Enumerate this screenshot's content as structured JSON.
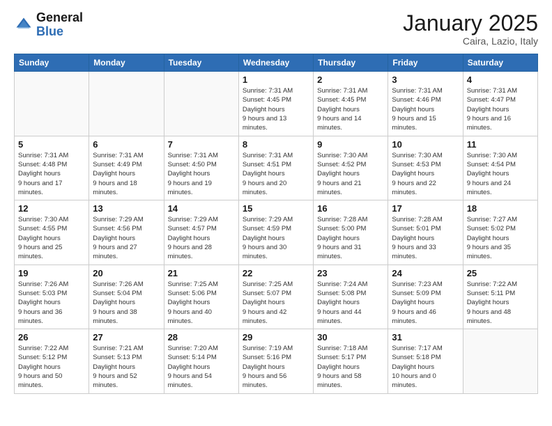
{
  "header": {
    "logo_general": "General",
    "logo_blue": "Blue",
    "month_title": "January 2025",
    "location": "Caira, Lazio, Italy"
  },
  "weekdays": [
    "Sunday",
    "Monday",
    "Tuesday",
    "Wednesday",
    "Thursday",
    "Friday",
    "Saturday"
  ],
  "weeks": [
    [
      {
        "day": "",
        "empty": true
      },
      {
        "day": "",
        "empty": true
      },
      {
        "day": "",
        "empty": true
      },
      {
        "day": "1",
        "sunrise": "7:31 AM",
        "sunset": "4:45 PM",
        "daylight": "9 hours and 13 minutes."
      },
      {
        "day": "2",
        "sunrise": "7:31 AM",
        "sunset": "4:45 PM",
        "daylight": "9 hours and 14 minutes."
      },
      {
        "day": "3",
        "sunrise": "7:31 AM",
        "sunset": "4:46 PM",
        "daylight": "9 hours and 15 minutes."
      },
      {
        "day": "4",
        "sunrise": "7:31 AM",
        "sunset": "4:47 PM",
        "daylight": "9 hours and 16 minutes."
      }
    ],
    [
      {
        "day": "5",
        "sunrise": "7:31 AM",
        "sunset": "4:48 PM",
        "daylight": "9 hours and 17 minutes."
      },
      {
        "day": "6",
        "sunrise": "7:31 AM",
        "sunset": "4:49 PM",
        "daylight": "9 hours and 18 minutes."
      },
      {
        "day": "7",
        "sunrise": "7:31 AM",
        "sunset": "4:50 PM",
        "daylight": "9 hours and 19 minutes."
      },
      {
        "day": "8",
        "sunrise": "7:31 AM",
        "sunset": "4:51 PM",
        "daylight": "9 hours and 20 minutes."
      },
      {
        "day": "9",
        "sunrise": "7:30 AM",
        "sunset": "4:52 PM",
        "daylight": "9 hours and 21 minutes."
      },
      {
        "day": "10",
        "sunrise": "7:30 AM",
        "sunset": "4:53 PM",
        "daylight": "9 hours and 22 minutes."
      },
      {
        "day": "11",
        "sunrise": "7:30 AM",
        "sunset": "4:54 PM",
        "daylight": "9 hours and 24 minutes."
      }
    ],
    [
      {
        "day": "12",
        "sunrise": "7:30 AM",
        "sunset": "4:55 PM",
        "daylight": "9 hours and 25 minutes."
      },
      {
        "day": "13",
        "sunrise": "7:29 AM",
        "sunset": "4:56 PM",
        "daylight": "9 hours and 27 minutes."
      },
      {
        "day": "14",
        "sunrise": "7:29 AM",
        "sunset": "4:57 PM",
        "daylight": "9 hours and 28 minutes."
      },
      {
        "day": "15",
        "sunrise": "7:29 AM",
        "sunset": "4:59 PM",
        "daylight": "9 hours and 30 minutes."
      },
      {
        "day": "16",
        "sunrise": "7:28 AM",
        "sunset": "5:00 PM",
        "daylight": "9 hours and 31 minutes."
      },
      {
        "day": "17",
        "sunrise": "7:28 AM",
        "sunset": "5:01 PM",
        "daylight": "9 hours and 33 minutes."
      },
      {
        "day": "18",
        "sunrise": "7:27 AM",
        "sunset": "5:02 PM",
        "daylight": "9 hours and 35 minutes."
      }
    ],
    [
      {
        "day": "19",
        "sunrise": "7:26 AM",
        "sunset": "5:03 PM",
        "daylight": "9 hours and 36 minutes."
      },
      {
        "day": "20",
        "sunrise": "7:26 AM",
        "sunset": "5:04 PM",
        "daylight": "9 hours and 38 minutes."
      },
      {
        "day": "21",
        "sunrise": "7:25 AM",
        "sunset": "5:06 PM",
        "daylight": "9 hours and 40 minutes."
      },
      {
        "day": "22",
        "sunrise": "7:25 AM",
        "sunset": "5:07 PM",
        "daylight": "9 hours and 42 minutes."
      },
      {
        "day": "23",
        "sunrise": "7:24 AM",
        "sunset": "5:08 PM",
        "daylight": "9 hours and 44 minutes."
      },
      {
        "day": "24",
        "sunrise": "7:23 AM",
        "sunset": "5:09 PM",
        "daylight": "9 hours and 46 minutes."
      },
      {
        "day": "25",
        "sunrise": "7:22 AM",
        "sunset": "5:11 PM",
        "daylight": "9 hours and 48 minutes."
      }
    ],
    [
      {
        "day": "26",
        "sunrise": "7:22 AM",
        "sunset": "5:12 PM",
        "daylight": "9 hours and 50 minutes."
      },
      {
        "day": "27",
        "sunrise": "7:21 AM",
        "sunset": "5:13 PM",
        "daylight": "9 hours and 52 minutes."
      },
      {
        "day": "28",
        "sunrise": "7:20 AM",
        "sunset": "5:14 PM",
        "daylight": "9 hours and 54 minutes."
      },
      {
        "day": "29",
        "sunrise": "7:19 AM",
        "sunset": "5:16 PM",
        "daylight": "9 hours and 56 minutes."
      },
      {
        "day": "30",
        "sunrise": "7:18 AM",
        "sunset": "5:17 PM",
        "daylight": "9 hours and 58 minutes."
      },
      {
        "day": "31",
        "sunrise": "7:17 AM",
        "sunset": "5:18 PM",
        "daylight": "10 hours and 0 minutes."
      },
      {
        "day": "",
        "empty": true
      }
    ]
  ],
  "labels": {
    "sunrise": "Sunrise:",
    "sunset": "Sunset:",
    "daylight": "Daylight hours"
  }
}
